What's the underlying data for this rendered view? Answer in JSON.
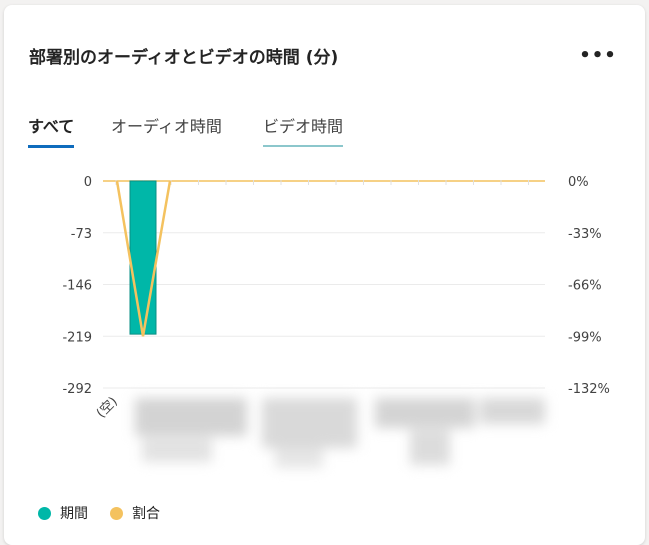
{
  "card": {
    "title": "部署別のオーディオとビデオの時間 (分)",
    "menu_icon": "more-horizontal-icon",
    "menu_label": "•••"
  },
  "tabs": [
    {
      "label": "すべて",
      "active": true
    },
    {
      "label": "オーディオ時間",
      "active": false
    },
    {
      "label": "ビデオ時間",
      "active": false
    }
  ],
  "chart_data": {
    "type": "bar",
    "categories": [
      "(空)"
    ],
    "series": [
      {
        "name": "期間",
        "type": "bar",
        "axis": "left",
        "color": "#00b7a8",
        "values": [
          -216
        ]
      },
      {
        "name": "割合",
        "type": "line",
        "axis": "right",
        "color": "#f4c25f",
        "values": [
          -99
        ]
      }
    ],
    "left_axis": {
      "ticks": [
        "0",
        "-73",
        "-146",
        "-219",
        "-292"
      ],
      "tick_values": [
        0,
        -73,
        -146,
        -219,
        -292
      ],
      "ylim": [
        -292,
        0
      ]
    },
    "right_axis": {
      "ticks": [
        "0%",
        "-33%",
        "-66%",
        "-99%",
        "-132%"
      ],
      "tick_values": [
        0,
        -33,
        -66,
        -99,
        -132
      ],
      "ylim": [
        -132,
        0
      ]
    },
    "grid": true,
    "legend_position": "bottom-left"
  },
  "legend": [
    {
      "label": "期間",
      "color": "#00b7a8"
    },
    {
      "label": "割合",
      "color": "#f4c25f"
    }
  ]
}
